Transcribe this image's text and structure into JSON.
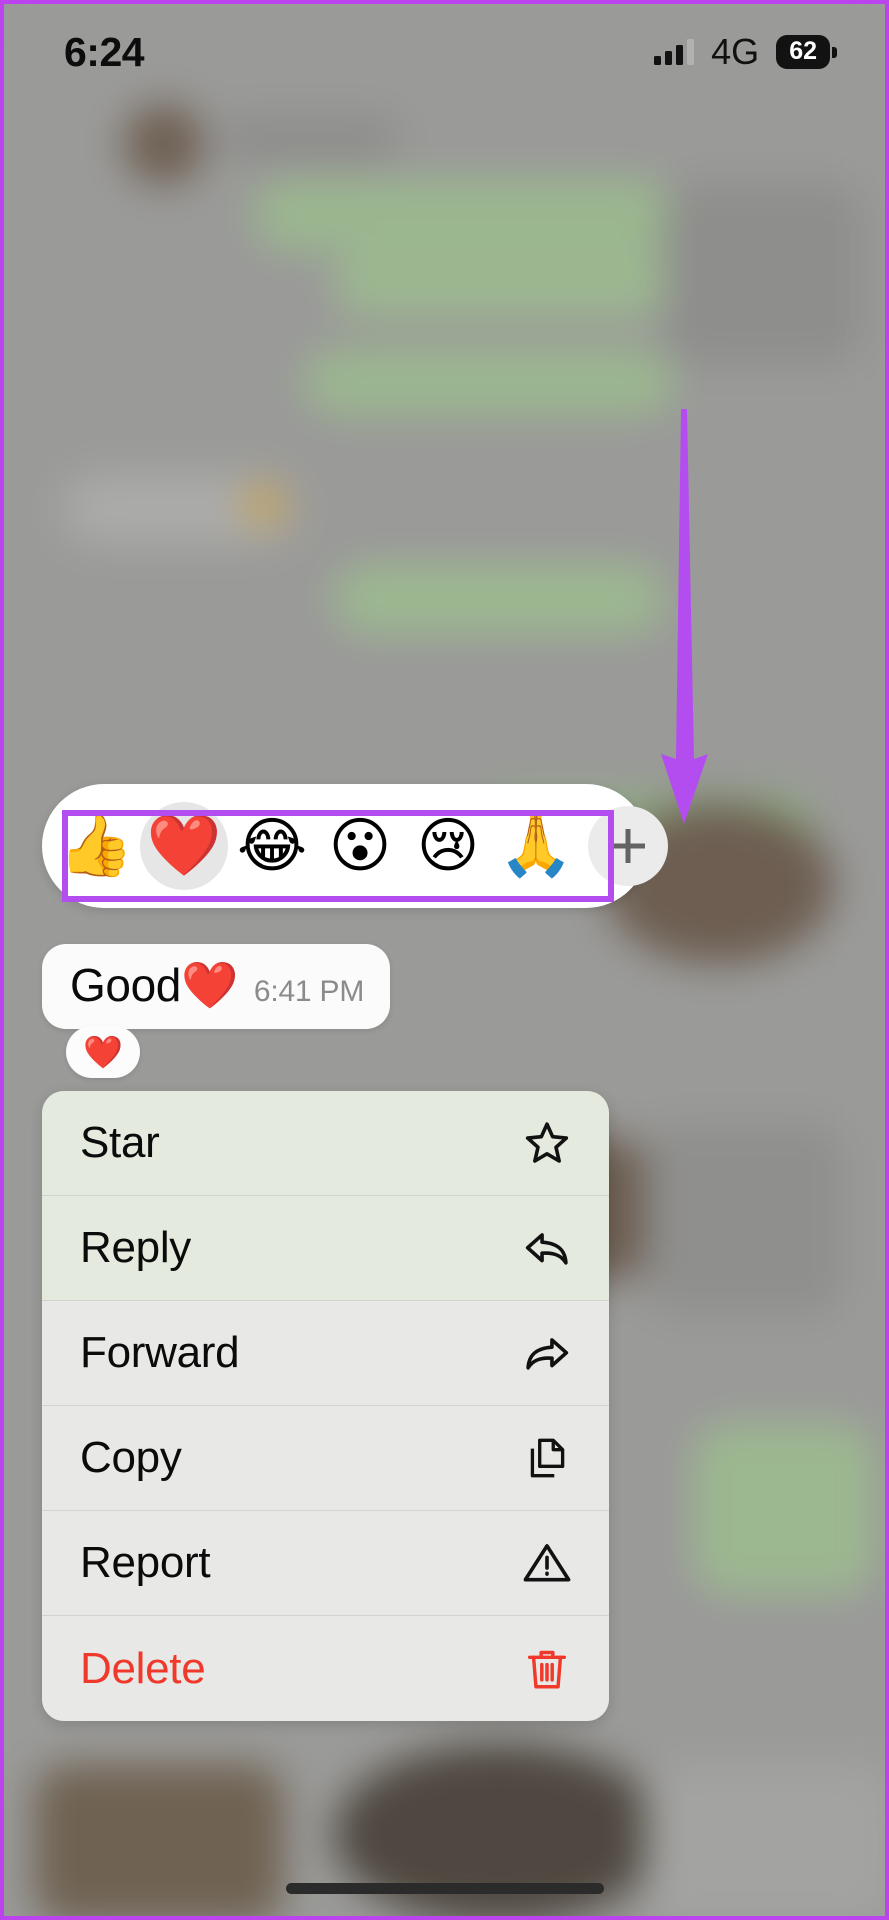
{
  "status_bar": {
    "time": "6:24",
    "network": "4G",
    "battery_percent": "62",
    "signal_icon": "cellular-bars-icon",
    "battery_icon": "battery-icon"
  },
  "annotation": {
    "arrow_icon": "down-arrow-annotation",
    "arrow_color": "#b44df0",
    "highlight_box_color": "#b44df0"
  },
  "reaction_bar": {
    "emojis": [
      {
        "name": "thumbs-up-emoji",
        "glyph": "👍",
        "selected": false
      },
      {
        "name": "red-heart-emoji",
        "glyph": "❤️",
        "selected": true
      },
      {
        "name": "joy-emoji",
        "glyph": "😂",
        "selected": false
      },
      {
        "name": "open-mouth-emoji",
        "glyph": "😮",
        "selected": false
      },
      {
        "name": "crying-face-emoji",
        "glyph": "😢",
        "selected": false
      },
      {
        "name": "folded-hands-emoji",
        "glyph": "🙏",
        "selected": false
      }
    ],
    "plus_button": {
      "name": "add-more-reactions-button",
      "icon": "plus-icon"
    }
  },
  "message": {
    "text": "Good",
    "emoji": "❤️",
    "timestamp": "6:41 PM",
    "reaction_chip": "❤️"
  },
  "context_menu": {
    "items": [
      {
        "label": "Star",
        "icon": "star-icon",
        "danger": false
      },
      {
        "label": "Reply",
        "icon": "reply-icon",
        "danger": false
      },
      {
        "label": "Forward",
        "icon": "forward-icon",
        "danger": false
      },
      {
        "label": "Copy",
        "icon": "copy-icon",
        "danger": false
      },
      {
        "label": "Report",
        "icon": "warning-icon",
        "danger": false
      },
      {
        "label": "Delete",
        "icon": "trash-icon",
        "danger": true
      }
    ]
  },
  "colors": {
    "accent_purple": "#b44df0",
    "danger_red": "#f0392b",
    "menu_background": "#e7eae3",
    "bubble_background": "#fbfbfb"
  },
  "home_indicator": "home-indicator-bar"
}
